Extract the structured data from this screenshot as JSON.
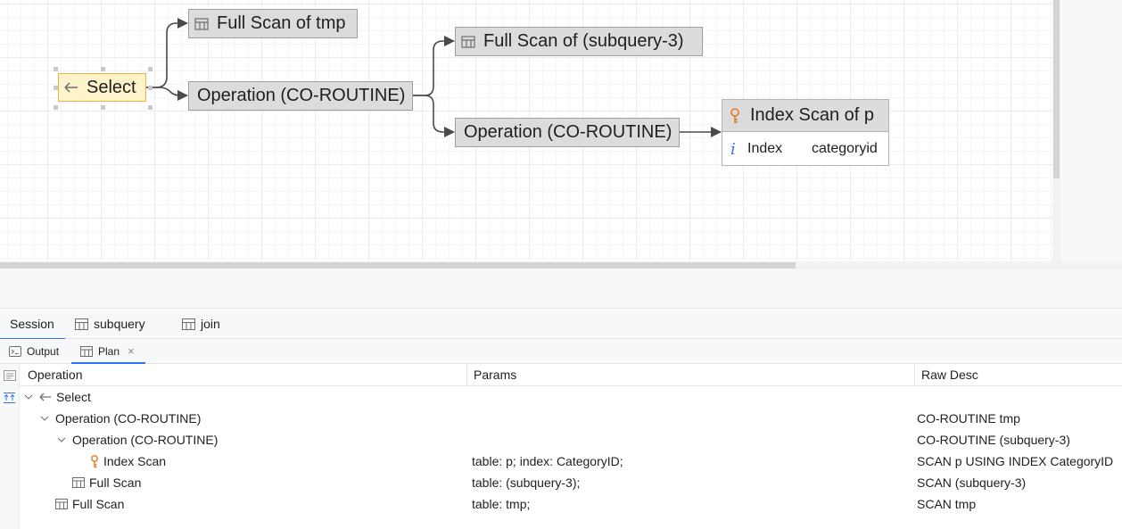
{
  "diagram": {
    "nodes": {
      "select": "Select",
      "full_scan_tmp": "Full Scan of tmp",
      "operation_1": "Operation (CO-ROUTINE)",
      "full_scan_subquery": "Full Scan of (subquery-3)",
      "operation_2": "Operation (CO-ROUTINE)",
      "index_scan_title": "Index Scan of p",
      "index_row_label": "Index",
      "index_row_value": "categoryid"
    }
  },
  "tabs": [
    {
      "label": "Session",
      "active": true
    },
    {
      "label": "subquery",
      "icon": "table-icon"
    },
    {
      "label": "join",
      "icon": "table-icon"
    }
  ],
  "subtabs": [
    {
      "label": "Output",
      "icon": "console-icon"
    },
    {
      "label": "Plan",
      "icon": "table-icon",
      "active": true,
      "closable": true
    }
  ],
  "grid": {
    "columns": [
      "Operation",
      "Params",
      "Raw Desc"
    ],
    "rows": [
      {
        "operation": "Select",
        "params": "",
        "raw": "",
        "icon": "select-arrow-icon"
      },
      {
        "operation": "Operation (CO-ROUTINE)",
        "params": "",
        "raw": "CO-ROUTINE tmp"
      },
      {
        "operation": "Operation (CO-ROUTINE)",
        "params": "",
        "raw": "CO-ROUTINE (subquery-3)"
      },
      {
        "operation": "Index Scan",
        "params": "table: p; index: CategoryID;",
        "raw": "SCAN p USING INDEX CategoryID",
        "icon": "key-icon"
      },
      {
        "operation": "Full Scan",
        "params": "table: (subquery-3);",
        "raw": "SCAN (subquery-3)",
        "icon": "table-icon"
      },
      {
        "operation": "Full Scan",
        "params": "table: tmp;",
        "raw": "SCAN tmp",
        "icon": "table-icon"
      }
    ]
  },
  "colors": {
    "accent": "#3574f0",
    "key_icon": "#e07b24",
    "info_icon": "#3574f0",
    "selected_node": "#fff3cc"
  }
}
